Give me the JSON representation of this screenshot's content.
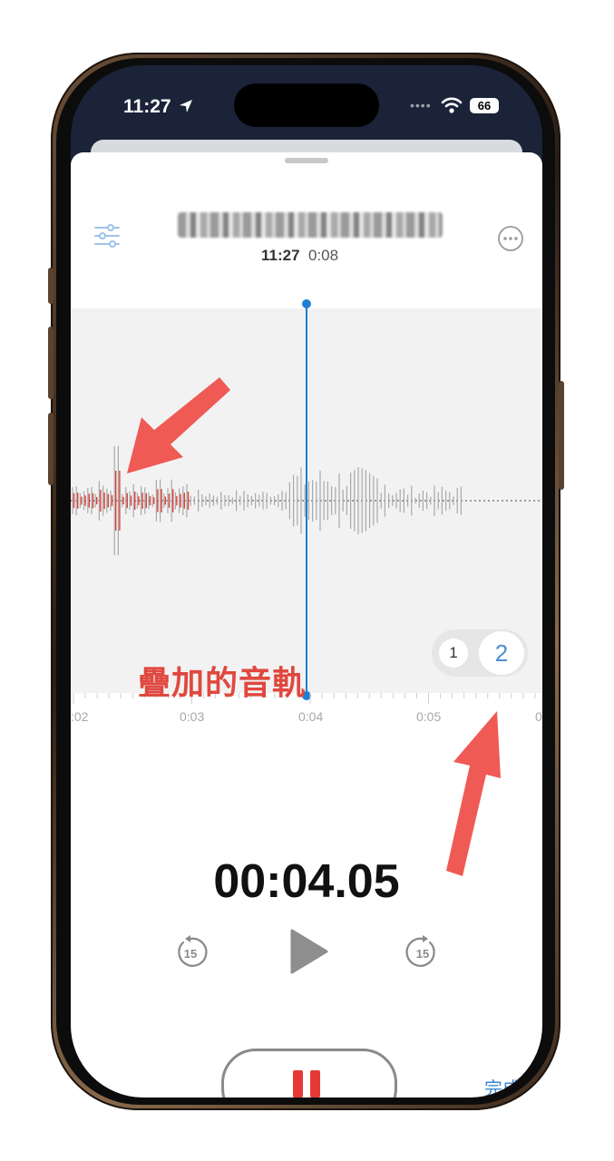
{
  "status_bar": {
    "time": "11:27",
    "battery": "66"
  },
  "recording": {
    "title": "",
    "clock_time": "11:27",
    "duration": "0:08"
  },
  "timeline": {
    "labels": [
      ":02",
      "0:03",
      "0:04",
      "0:05",
      "0"
    ]
  },
  "track_toggle": {
    "option_1": "1",
    "option_2": "2",
    "selected": "2"
  },
  "annotation": {
    "label": "疊加的音軌"
  },
  "playback": {
    "elapsed": "00:04.05",
    "skip_back_seconds": "15",
    "skip_forward_seconds": "15"
  },
  "actions": {
    "done": "完成"
  },
  "colors": {
    "accent": "#1f7ed6",
    "record_red": "#e53935",
    "annotation_red": "#e0483f",
    "link_blue": "#3b8ad6"
  },
  "icons": [
    "location-arrow-icon",
    "wifi-icon",
    "battery-icon",
    "options-sliders-icon",
    "more-ellipsis-icon",
    "skip-back-15-icon",
    "play-icon",
    "skip-forward-15-icon",
    "pause-icon"
  ]
}
